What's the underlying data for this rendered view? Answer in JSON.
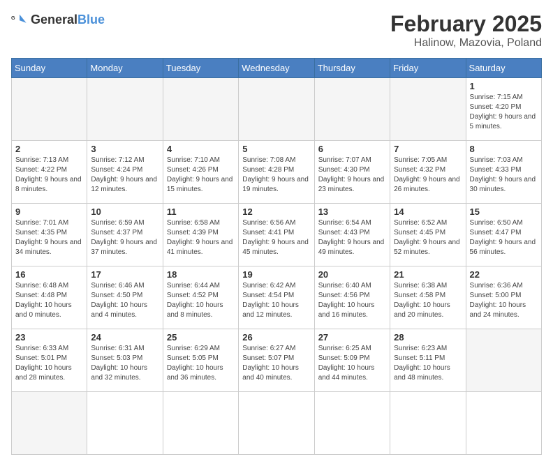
{
  "header": {
    "logo_general": "General",
    "logo_blue": "Blue",
    "month_year": "February 2025",
    "location": "Halinow, Mazovia, Poland"
  },
  "weekdays": [
    "Sunday",
    "Monday",
    "Tuesday",
    "Wednesday",
    "Thursday",
    "Friday",
    "Saturday"
  ],
  "days": [
    {
      "date": "",
      "info": ""
    },
    {
      "date": "",
      "info": ""
    },
    {
      "date": "",
      "info": ""
    },
    {
      "date": "",
      "info": ""
    },
    {
      "date": "",
      "info": ""
    },
    {
      "date": "",
      "info": ""
    },
    {
      "date": "1",
      "info": "Sunrise: 7:15 AM\nSunset: 4:20 PM\nDaylight: 9 hours and 5 minutes."
    },
    {
      "date": "2",
      "info": "Sunrise: 7:13 AM\nSunset: 4:22 PM\nDaylight: 9 hours and 8 minutes."
    },
    {
      "date": "3",
      "info": "Sunrise: 7:12 AM\nSunset: 4:24 PM\nDaylight: 9 hours and 12 minutes."
    },
    {
      "date": "4",
      "info": "Sunrise: 7:10 AM\nSunset: 4:26 PM\nDaylight: 9 hours and 15 minutes."
    },
    {
      "date": "5",
      "info": "Sunrise: 7:08 AM\nSunset: 4:28 PM\nDaylight: 9 hours and 19 minutes."
    },
    {
      "date": "6",
      "info": "Sunrise: 7:07 AM\nSunset: 4:30 PM\nDaylight: 9 hours and 23 minutes."
    },
    {
      "date": "7",
      "info": "Sunrise: 7:05 AM\nSunset: 4:32 PM\nDaylight: 9 hours and 26 minutes."
    },
    {
      "date": "8",
      "info": "Sunrise: 7:03 AM\nSunset: 4:33 PM\nDaylight: 9 hours and 30 minutes."
    },
    {
      "date": "9",
      "info": "Sunrise: 7:01 AM\nSunset: 4:35 PM\nDaylight: 9 hours and 34 minutes."
    },
    {
      "date": "10",
      "info": "Sunrise: 6:59 AM\nSunset: 4:37 PM\nDaylight: 9 hours and 37 minutes."
    },
    {
      "date": "11",
      "info": "Sunrise: 6:58 AM\nSunset: 4:39 PM\nDaylight: 9 hours and 41 minutes."
    },
    {
      "date": "12",
      "info": "Sunrise: 6:56 AM\nSunset: 4:41 PM\nDaylight: 9 hours and 45 minutes."
    },
    {
      "date": "13",
      "info": "Sunrise: 6:54 AM\nSunset: 4:43 PM\nDaylight: 9 hours and 49 minutes."
    },
    {
      "date": "14",
      "info": "Sunrise: 6:52 AM\nSunset: 4:45 PM\nDaylight: 9 hours and 52 minutes."
    },
    {
      "date": "15",
      "info": "Sunrise: 6:50 AM\nSunset: 4:47 PM\nDaylight: 9 hours and 56 minutes."
    },
    {
      "date": "16",
      "info": "Sunrise: 6:48 AM\nSunset: 4:48 PM\nDaylight: 10 hours and 0 minutes."
    },
    {
      "date": "17",
      "info": "Sunrise: 6:46 AM\nSunset: 4:50 PM\nDaylight: 10 hours and 4 minutes."
    },
    {
      "date": "18",
      "info": "Sunrise: 6:44 AM\nSunset: 4:52 PM\nDaylight: 10 hours and 8 minutes."
    },
    {
      "date": "19",
      "info": "Sunrise: 6:42 AM\nSunset: 4:54 PM\nDaylight: 10 hours and 12 minutes."
    },
    {
      "date": "20",
      "info": "Sunrise: 6:40 AM\nSunset: 4:56 PM\nDaylight: 10 hours and 16 minutes."
    },
    {
      "date": "21",
      "info": "Sunrise: 6:38 AM\nSunset: 4:58 PM\nDaylight: 10 hours and 20 minutes."
    },
    {
      "date": "22",
      "info": "Sunrise: 6:36 AM\nSunset: 5:00 PM\nDaylight: 10 hours and 24 minutes."
    },
    {
      "date": "23",
      "info": "Sunrise: 6:33 AM\nSunset: 5:01 PM\nDaylight: 10 hours and 28 minutes."
    },
    {
      "date": "24",
      "info": "Sunrise: 6:31 AM\nSunset: 5:03 PM\nDaylight: 10 hours and 32 minutes."
    },
    {
      "date": "25",
      "info": "Sunrise: 6:29 AM\nSunset: 5:05 PM\nDaylight: 10 hours and 36 minutes."
    },
    {
      "date": "26",
      "info": "Sunrise: 6:27 AM\nSunset: 5:07 PM\nDaylight: 10 hours and 40 minutes."
    },
    {
      "date": "27",
      "info": "Sunrise: 6:25 AM\nSunset: 5:09 PM\nDaylight: 10 hours and 44 minutes."
    },
    {
      "date": "28",
      "info": "Sunrise: 6:23 AM\nSunset: 5:11 PM\nDaylight: 10 hours and 48 minutes."
    },
    {
      "date": "",
      "info": ""
    },
    {
      "date": "",
      "info": ""
    }
  ]
}
